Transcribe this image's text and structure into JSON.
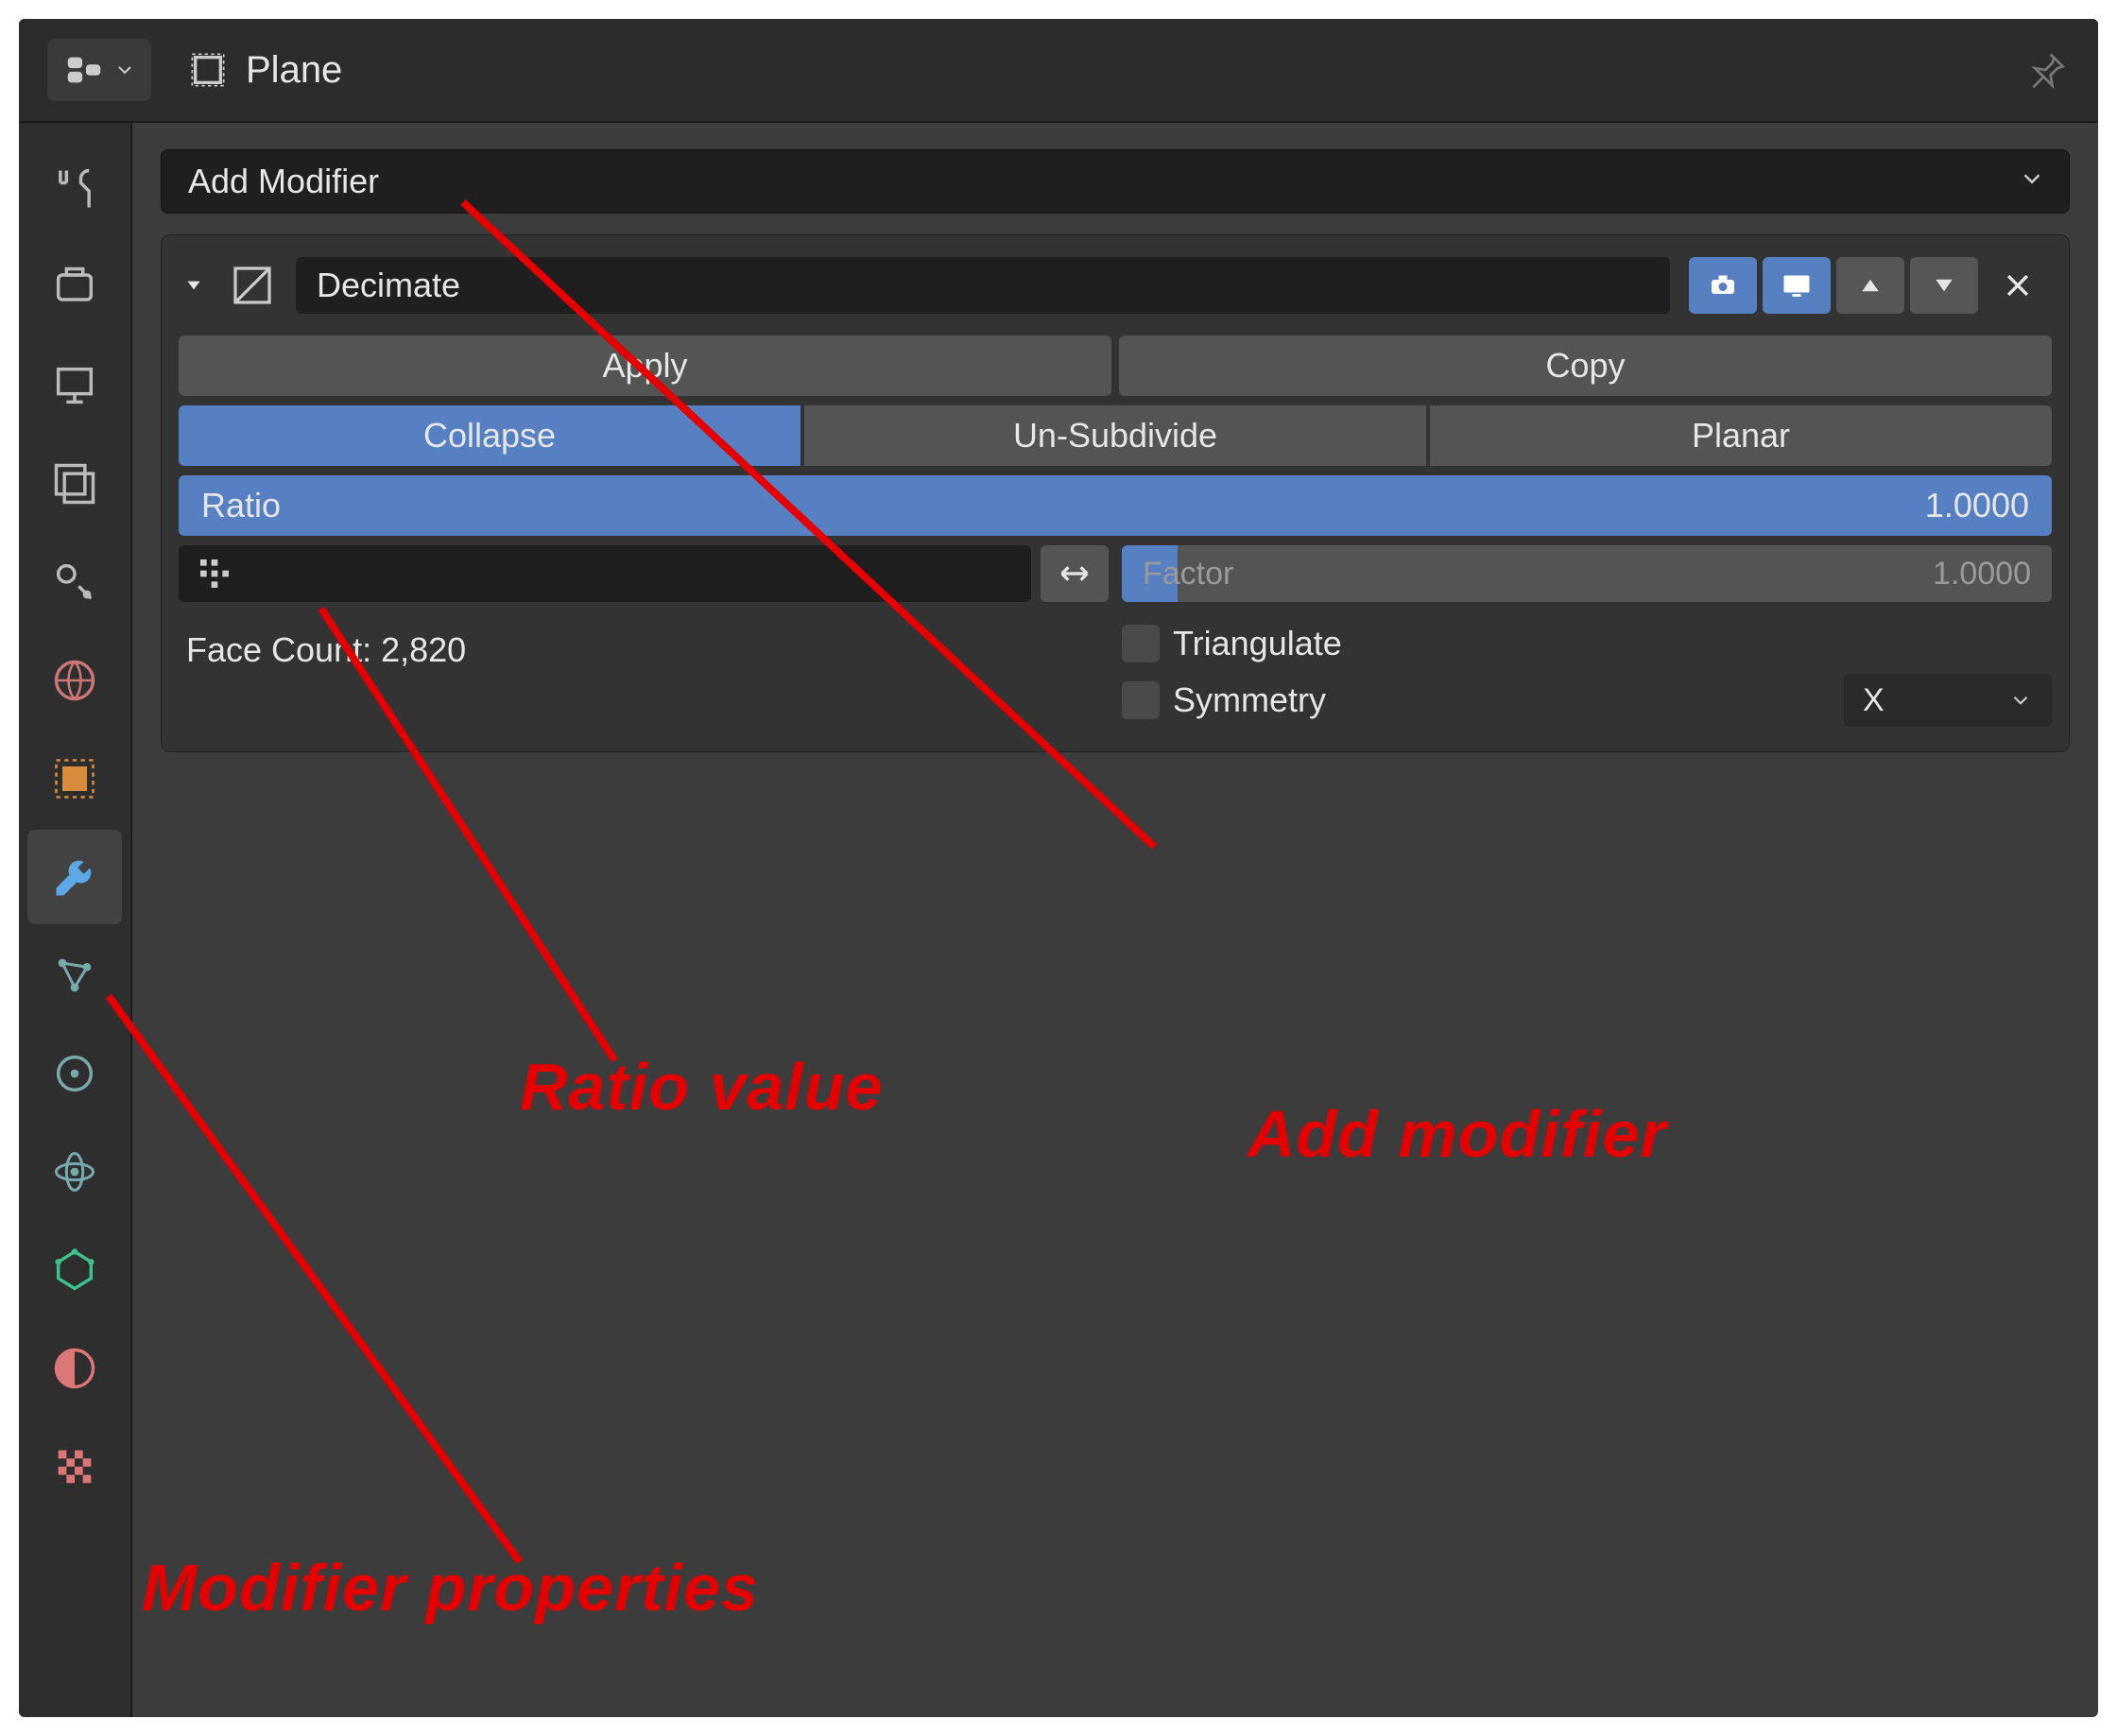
{
  "header": {
    "object_name": "Plane"
  },
  "add_modifier_label": "Add Modifier",
  "modifier": {
    "name": "Decimate",
    "apply_label": "Apply",
    "copy_label": "Copy",
    "modes": {
      "collapse": "Collapse",
      "unsubdivide": "Un-Subdivide",
      "planar": "Planar"
    },
    "ratio_label": "Ratio",
    "ratio_value": "1.0000",
    "factor_label": "Factor",
    "factor_value": "1.0000",
    "face_count_label": "Face Count: 2,820",
    "triangulate_label": "Triangulate",
    "symmetry_label": "Symmetry",
    "symmetry_axis": "X"
  },
  "annotations": {
    "ratio_value": "Ratio value",
    "add_modifier": "Add modifier",
    "modifier_properties": "Modifier properties"
  }
}
